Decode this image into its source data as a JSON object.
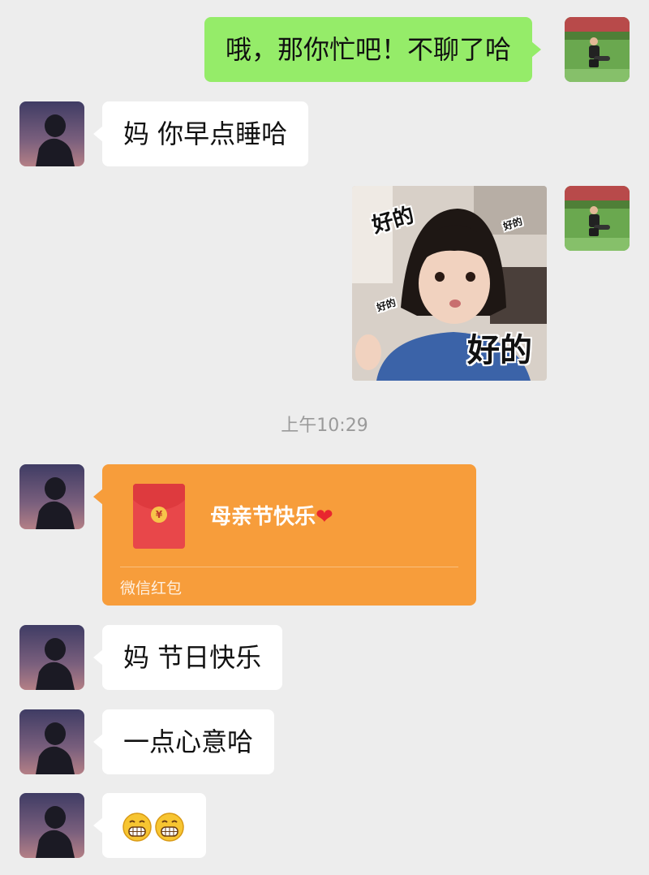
{
  "messages": {
    "m1": {
      "text": "哦，那你忙吧！不聊了哈"
    },
    "m2": {
      "text": "妈  你早点睡哈"
    },
    "sticker": {
      "caption_small_1": "好的",
      "caption_small_2": "好的",
      "caption_small_3": "好的",
      "caption_big": "好的"
    },
    "timestamp": "上午10:29",
    "redpacket": {
      "title": "母亲节快乐",
      "heart": "❤",
      "footer": "微信红包",
      "coin_symbol": "¥"
    },
    "m3": {
      "text": "妈 节日快乐"
    },
    "m4": {
      "text": "一点心意哈"
    },
    "m5": {
      "emojis": [
        "grinning-face-icon",
        "grinning-face-icon"
      ]
    }
  },
  "colors": {
    "background": "#ededed",
    "outgoing_bubble": "#95ec69",
    "incoming_bubble": "#ffffff",
    "redpacket": "#f79d3b",
    "timestamp_text": "#9a9a9a"
  }
}
